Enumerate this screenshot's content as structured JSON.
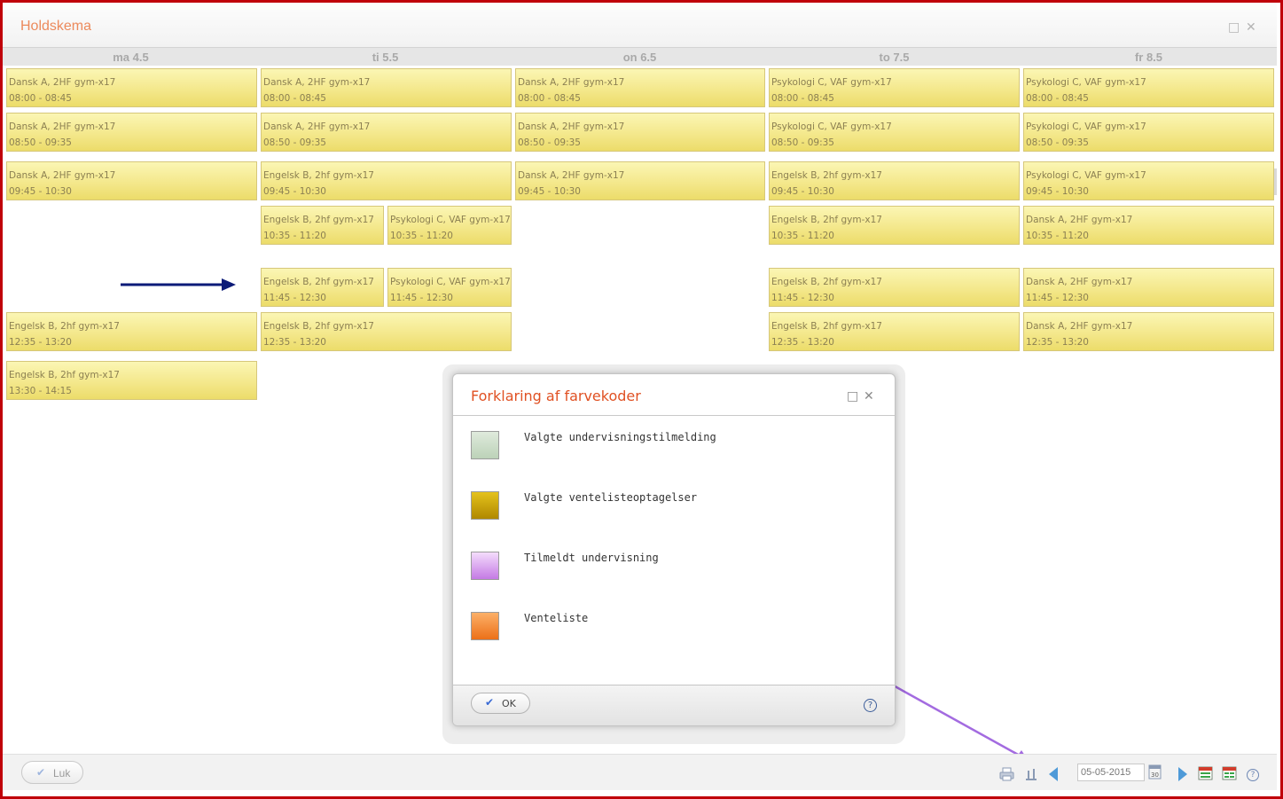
{
  "window": {
    "title": "Holdskema"
  },
  "days": [
    "ma 4.5",
    "ti 5.5",
    "on 6.5",
    "to 7.5",
    "fr 8.5"
  ],
  "lessons": [
    {
      "course": "Dansk A, 2HF gym-x17",
      "time": "08:00 - 08:45"
    },
    {
      "course": "Dansk A, 2HF gym-x17",
      "time": "08:50 - 09:35"
    },
    {
      "course": "Dansk A, 2HF gym-x17",
      "time": "09:45 - 10:30"
    },
    {
      "course": "Engelsk B, 2hf gym-x17",
      "time": "12:35 - 13:20"
    },
    {
      "course": "Engelsk B, 2hf gym-x17",
      "time": "13:30 - 14:15"
    },
    {
      "course": "Dansk A, 2HF gym-x17",
      "time": "08:00 - 08:45"
    },
    {
      "course": "Dansk A, 2HF gym-x17",
      "time": "08:50 - 09:35"
    },
    {
      "course": "Engelsk B, 2hf gym-x17",
      "time": "09:45 - 10:30"
    },
    {
      "course": "Engelsk B, 2hf gym-x17",
      "time": "10:35 - 11:20"
    },
    {
      "course": "Psykologi C, VAF gym-x17",
      "time": "10:35 - 11:20"
    },
    {
      "course": "Engelsk B, 2hf gym-x17",
      "time": "11:45 - 12:30"
    },
    {
      "course": "Psykologi C, VAF gym-x17",
      "time": "11:45 - 12:30"
    },
    {
      "course": "Engelsk B, 2hf gym-x17",
      "time": "12:35 - 13:20"
    },
    {
      "course": "Dansk A, 2HF gym-x17",
      "time": "08:00 - 08:45"
    },
    {
      "course": "Dansk A, 2HF gym-x17",
      "time": "08:50 - 09:35"
    },
    {
      "course": "Dansk A, 2HF gym-x17",
      "time": "09:45 - 10:30"
    },
    {
      "course": "Psykologi C, VAF gym-x17",
      "time": "08:00 - 08:45"
    },
    {
      "course": "Psykologi C, VAF gym-x17",
      "time": "08:50 - 09:35"
    },
    {
      "course": "Engelsk B, 2hf gym-x17",
      "time": "09:45 - 10:30"
    },
    {
      "course": "Engelsk B, 2hf gym-x17",
      "time": "10:35 - 11:20"
    },
    {
      "course": "Engelsk B, 2hf gym-x17",
      "time": "11:45 - 12:30"
    },
    {
      "course": "Engelsk B, 2hf gym-x17",
      "time": "12:35 - 13:20"
    },
    {
      "course": "Psykologi C, VAF gym-x17",
      "time": "08:00 - 08:45"
    },
    {
      "course": "Psykologi C, VAF gym-x17",
      "time": "08:50 - 09:35"
    },
    {
      "course": "Psykologi C, VAF gym-x17",
      "time": "09:45 - 10:30"
    },
    {
      "course": "Dansk A, 2HF gym-x17",
      "time": "10:35 - 11:20"
    },
    {
      "course": "Dansk A, 2HF gym-x17",
      "time": "11:45 - 12:30"
    },
    {
      "course": "Dansk A, 2HF gym-x17",
      "time": "12:35 - 13:20"
    }
  ],
  "dialog": {
    "title": "Forklaring af farvekoder",
    "legend": [
      {
        "label": "Valgte undervisningstilmelding",
        "color": "#c8dcc4"
      },
      {
        "label": "Valgte ventelisteoptagelser",
        "color": "#c8a000"
      },
      {
        "label": "Tilmeldt undervisning",
        "color": "#d48cec"
      },
      {
        "label": "Venteliste",
        "color": "#f48a30"
      }
    ],
    "ok_label": "OK",
    "help_label": "?"
  },
  "bottombar": {
    "close_label": "Luk",
    "date_value": "05-05-2015",
    "help_label": "?"
  },
  "colors": {
    "frame": "#c0000a",
    "lesson": "#f4e88c",
    "title": "#ec8a5c",
    "dialog_title": "#e05123"
  },
  "icons": [
    "print-icon",
    "legend-icon",
    "previous-week-icon",
    "calendar-icon",
    "next-week-icon",
    "day-view-icon",
    "week-view-icon",
    "help-icon"
  ]
}
